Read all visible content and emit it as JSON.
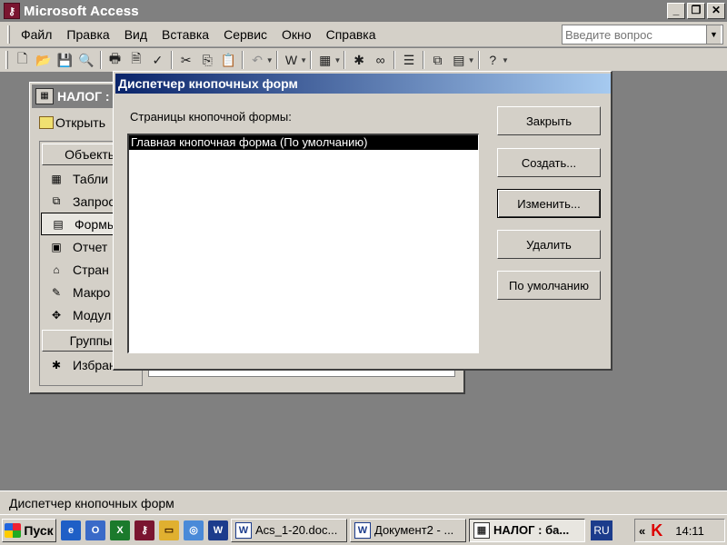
{
  "app": {
    "title": "Microsoft Access",
    "icon": "access-key-icon"
  },
  "window_controls": {
    "minimize": "_",
    "restore": "❐",
    "close": "✕"
  },
  "menubar": {
    "items": [
      "Файл",
      "Правка",
      "Вид",
      "Вставка",
      "Сервис",
      "Окно",
      "Справка"
    ]
  },
  "help_box": {
    "placeholder": "Введите вопрос"
  },
  "toolbar": {
    "icons": [
      "new-icon",
      "open-icon",
      "save-icon",
      "search-icon",
      "print-icon",
      "print-preview-icon",
      "spelling-icon",
      "cut-icon",
      "copy-icon",
      "paste-icon",
      "undo-icon",
      "office-links-icon",
      "analyze-icon",
      "code-icon",
      "script-icon",
      "properties-icon",
      "relationships-icon",
      "new-object-icon",
      "help-icon"
    ]
  },
  "db_window": {
    "title": "НАЛОГ :",
    "open_label": "Открыть",
    "objects_header": "Объекты",
    "objects": [
      "Табли",
      "Запрос",
      "Формы",
      "Отчет",
      "Стран",
      "Макро",
      "Модул"
    ],
    "groups_header": "Группы",
    "favorites": "Избран"
  },
  "dialog": {
    "title": "Диспетчер кнопочных форм",
    "list_label": "Страницы кнопочной формы:",
    "pages": [
      "Главная кнопочная форма (По умолчанию)"
    ],
    "buttons": {
      "close": "Закрыть",
      "create": "Создать...",
      "edit": "Изменить...",
      "delete": "Удалить",
      "default": "По умолчанию"
    }
  },
  "statusbar": {
    "text": "Диспетчер кнопочных форм"
  },
  "taskbar": {
    "start": "Пуск",
    "tasks": [
      {
        "label": "Acs_1-20.doc...",
        "icon": "word-icon"
      },
      {
        "label": "Документ2 - ...",
        "icon": "word-icon"
      },
      {
        "label": "НАЛОГ : ба...",
        "icon": "access-db-icon"
      }
    ],
    "lang": "RU",
    "tray_arrow": "«",
    "antivirus": "K",
    "clock": "14:11"
  }
}
